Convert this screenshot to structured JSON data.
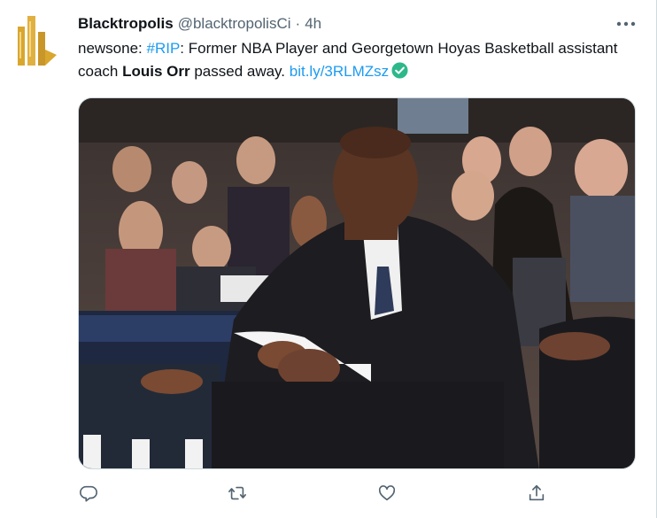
{
  "tweet": {
    "display_name": "Blacktropolis",
    "handle": "@blacktropolisCi",
    "separator": "·",
    "time": "4h",
    "text": {
      "prefix": "newsone: ",
      "hashtag": "#RIP",
      "part1": ": Former NBA Player and Georgetown Hoyas Basketball assistant coach ",
      "bold_name": "Louis Orr",
      "part2": " passed away. ",
      "link": "bit.ly/3RLMZsz"
    }
  },
  "icons": {
    "avatar": "blacktropolis-logo",
    "more": "more-horizontal-icon",
    "verified": "verified-check-icon",
    "reply": "reply-icon",
    "retweet": "retweet-icon",
    "like": "like-icon",
    "share": "share-icon"
  },
  "colors": {
    "accent": "#1d9bf0",
    "verified_badge": "#2db88a",
    "secondary_text": "#536471",
    "logo_gold": "#d9a62e"
  }
}
